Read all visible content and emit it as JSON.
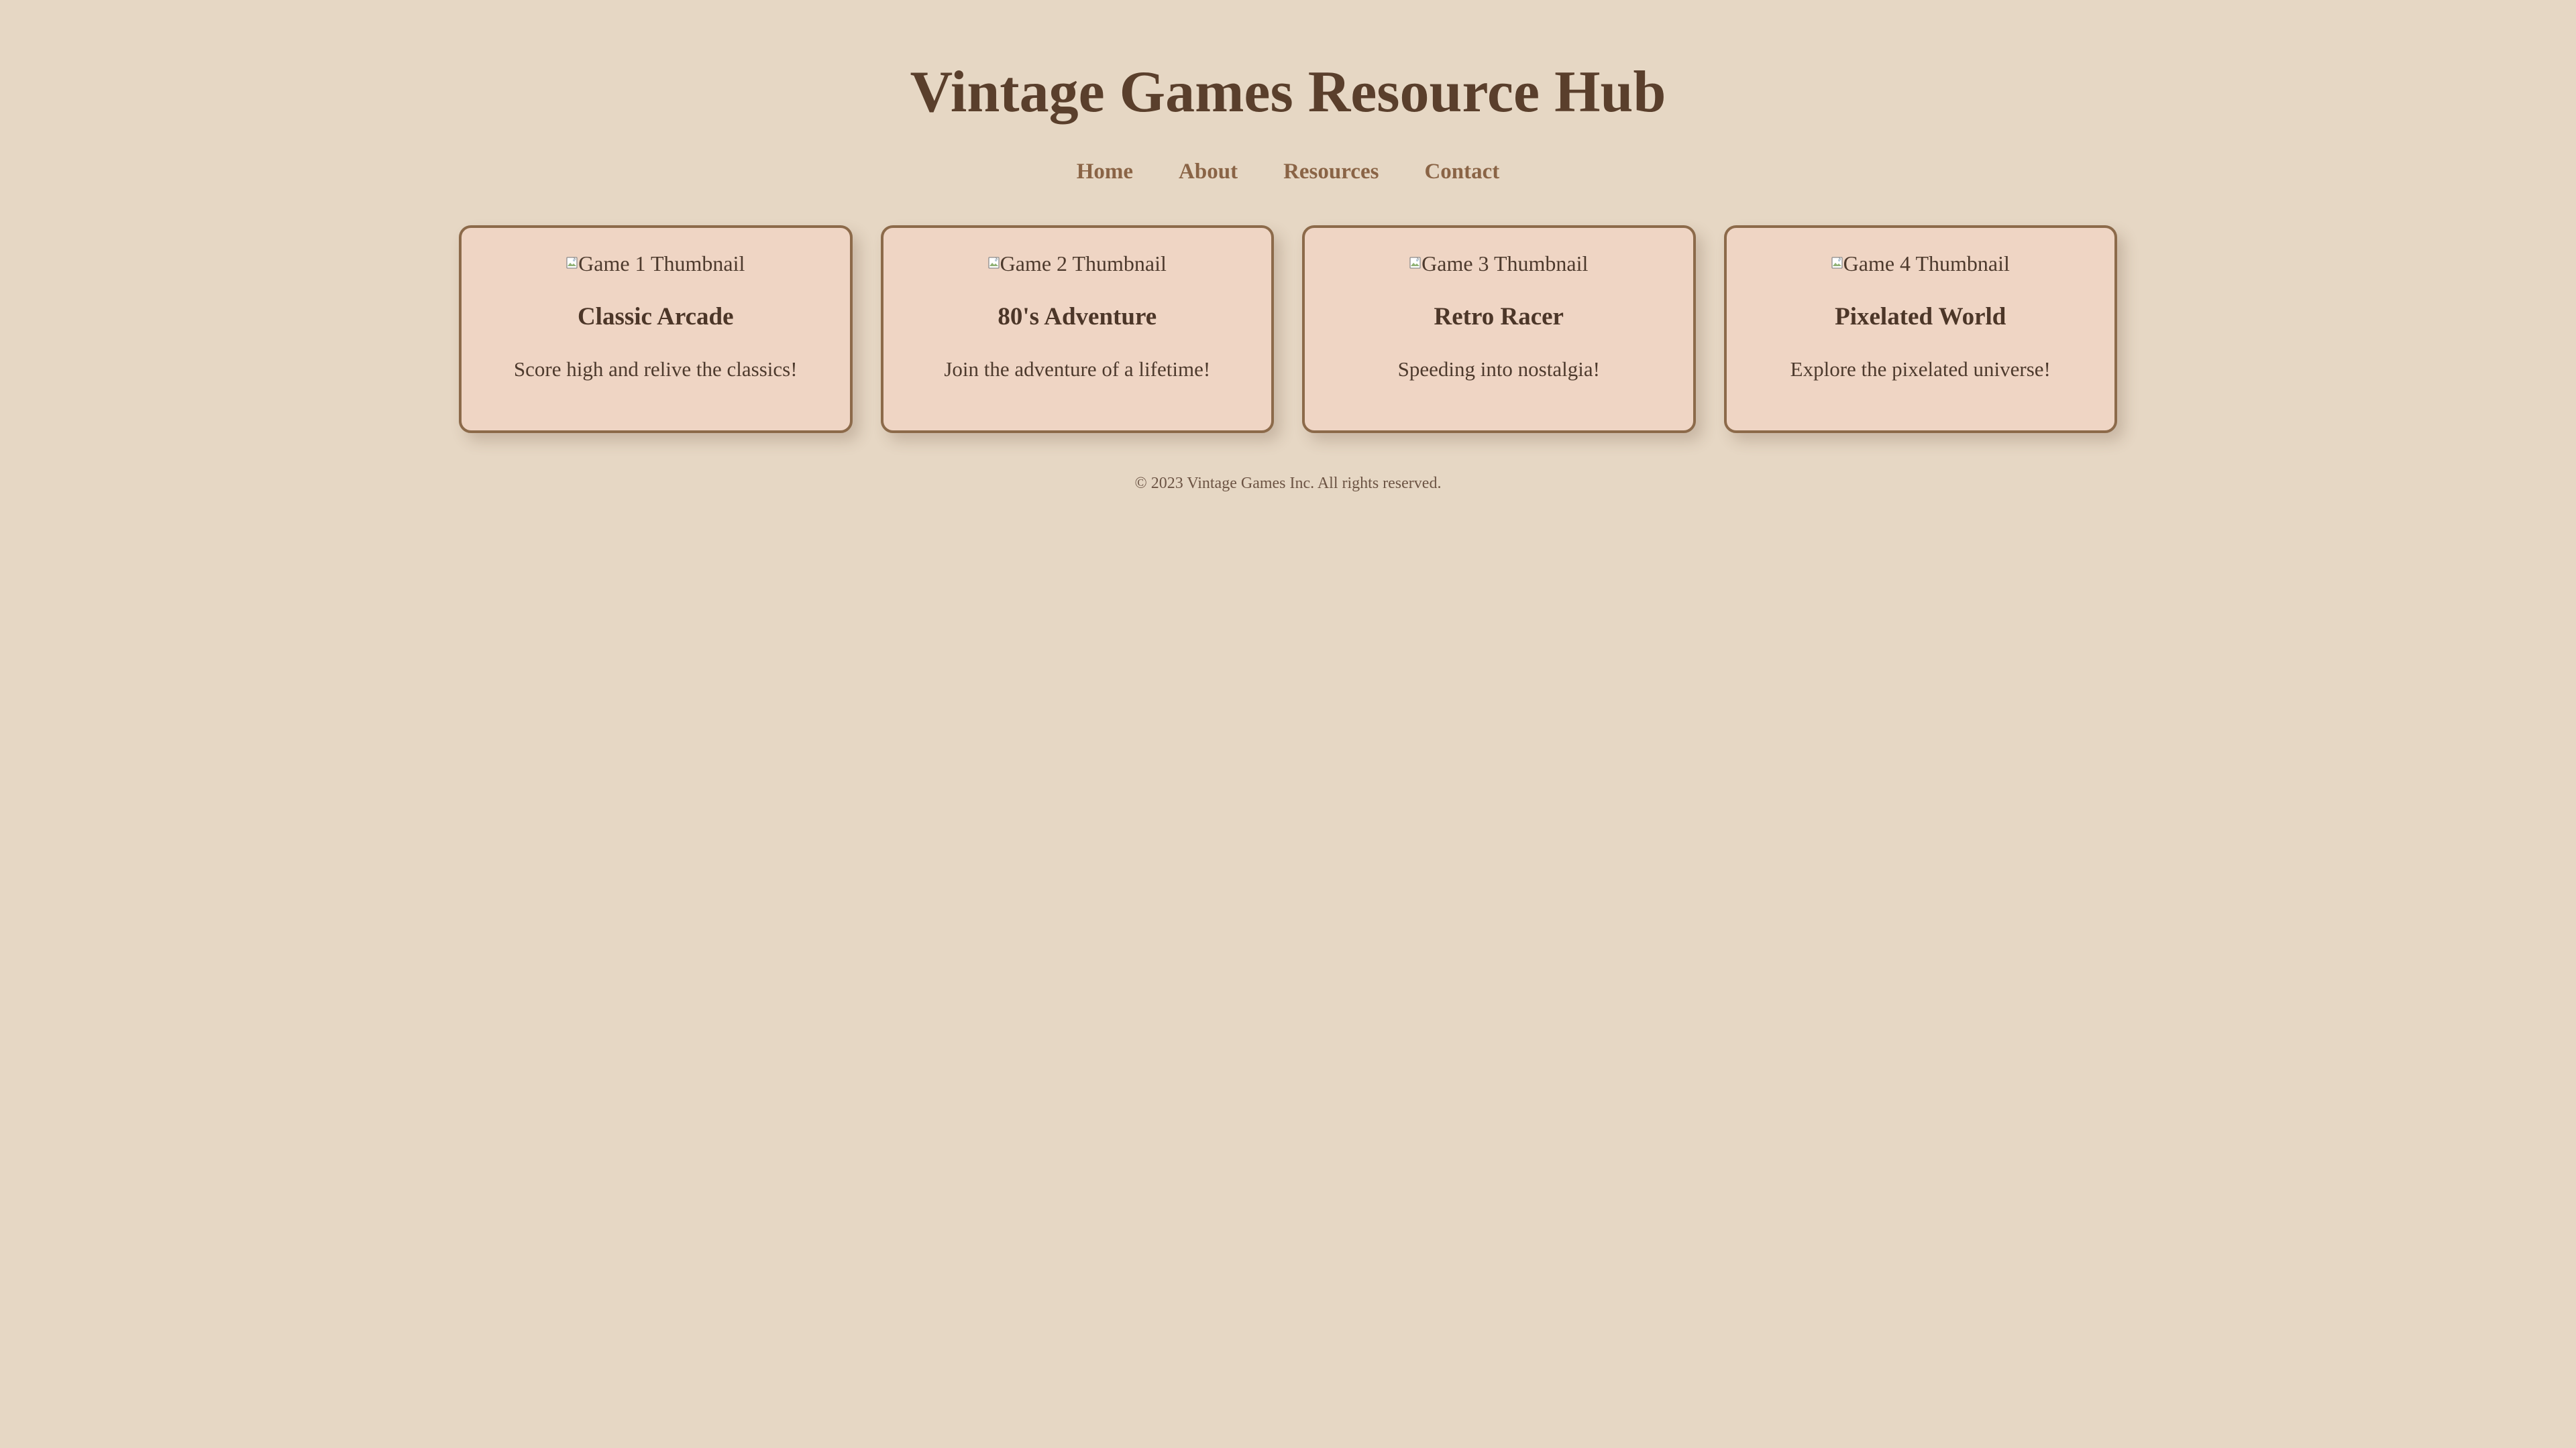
{
  "header": {
    "title": "Vintage Games Resource Hub"
  },
  "nav": {
    "items": [
      {
        "label": "Home"
      },
      {
        "label": "About"
      },
      {
        "label": "Resources"
      },
      {
        "label": "Contact"
      }
    ]
  },
  "cards": [
    {
      "image_alt": "Game 1 Thumbnail",
      "title": "Classic Arcade",
      "description": "Score high and relive the classics!"
    },
    {
      "image_alt": "Game 2 Thumbnail",
      "title": "80's Adventure",
      "description": "Join the adventure of a lifetime!"
    },
    {
      "image_alt": "Game 3 Thumbnail",
      "title": "Retro Racer",
      "description": "Speeding into nostalgia!"
    },
    {
      "image_alt": "Game 4 Thumbnail",
      "title": "Pixelated World",
      "description": "Explore the pixelated universe!"
    }
  ],
  "footer": {
    "text": "© 2023 Vintage Games Inc. All rights reserved."
  },
  "colors": {
    "background": "#e6d7c4",
    "card_background": "#efd5c4",
    "card_border": "#8c6a4a",
    "title_text": "#5a3f2c",
    "nav_text": "#8a6446"
  },
  "icons": {
    "thumbnail": "broken-image-icon"
  }
}
